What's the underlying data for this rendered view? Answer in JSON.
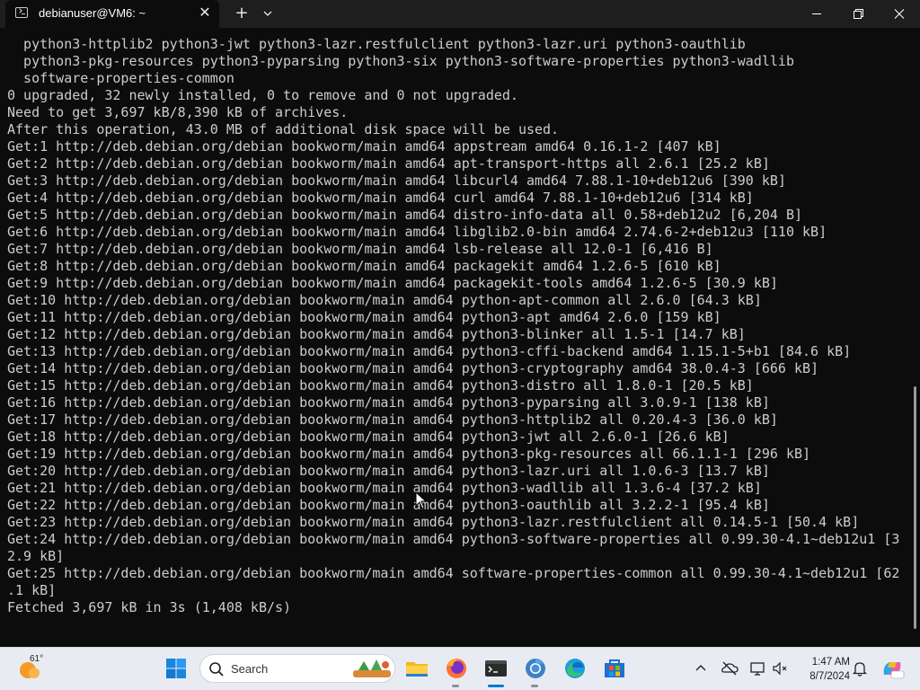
{
  "window": {
    "tab_title": "debianuser@VM6: ~",
    "tab_close_glyph": "✕",
    "new_tab_glyph": "+"
  },
  "terminal": {
    "lines": [
      "  python3-httplib2 python3-jwt python3-lazr.restfulclient python3-lazr.uri python3-oauthlib",
      "  python3-pkg-resources python3-pyparsing python3-six python3-software-properties python3-wadllib",
      "  software-properties-common",
      "0 upgraded, 32 newly installed, 0 to remove and 0 not upgraded.",
      "Need to get 3,697 kB/8,390 kB of archives.",
      "After this operation, 43.0 MB of additional disk space will be used.",
      "Get:1 http://deb.debian.org/debian bookworm/main amd64 appstream amd64 0.16.1-2 [407 kB]",
      "Get:2 http://deb.debian.org/debian bookworm/main amd64 apt-transport-https all 2.6.1 [25.2 kB]",
      "Get:3 http://deb.debian.org/debian bookworm/main amd64 libcurl4 amd64 7.88.1-10+deb12u6 [390 kB]",
      "Get:4 http://deb.debian.org/debian bookworm/main amd64 curl amd64 7.88.1-10+deb12u6 [314 kB]",
      "Get:5 http://deb.debian.org/debian bookworm/main amd64 distro-info-data all 0.58+deb12u2 [6,204 B]",
      "Get:6 http://deb.debian.org/debian bookworm/main amd64 libglib2.0-bin amd64 2.74.6-2+deb12u3 [110 kB]",
      "Get:7 http://deb.debian.org/debian bookworm/main amd64 lsb-release all 12.0-1 [6,416 B]",
      "Get:8 http://deb.debian.org/debian bookworm/main amd64 packagekit amd64 1.2.6-5 [610 kB]",
      "Get:9 http://deb.debian.org/debian bookworm/main amd64 packagekit-tools amd64 1.2.6-5 [30.9 kB]",
      "Get:10 http://deb.debian.org/debian bookworm/main amd64 python-apt-common all 2.6.0 [64.3 kB]",
      "Get:11 http://deb.debian.org/debian bookworm/main amd64 python3-apt amd64 2.6.0 [159 kB]",
      "Get:12 http://deb.debian.org/debian bookworm/main amd64 python3-blinker all 1.5-1 [14.7 kB]",
      "Get:13 http://deb.debian.org/debian bookworm/main amd64 python3-cffi-backend amd64 1.15.1-5+b1 [84.6 kB]",
      "Get:14 http://deb.debian.org/debian bookworm/main amd64 python3-cryptography amd64 38.0.4-3 [666 kB]",
      "Get:15 http://deb.debian.org/debian bookworm/main amd64 python3-distro all 1.8.0-1 [20.5 kB]",
      "Get:16 http://deb.debian.org/debian bookworm/main amd64 python3-pyparsing all 3.0.9-1 [138 kB]",
      "Get:17 http://deb.debian.org/debian bookworm/main amd64 python3-httplib2 all 0.20.4-3 [36.0 kB]",
      "Get:18 http://deb.debian.org/debian bookworm/main amd64 python3-jwt all 2.6.0-1 [26.6 kB]",
      "Get:19 http://deb.debian.org/debian bookworm/main amd64 python3-pkg-resources all 66.1.1-1 [296 kB]",
      "Get:20 http://deb.debian.org/debian bookworm/main amd64 python3-lazr.uri all 1.0.6-3 [13.7 kB]",
      "Get:21 http://deb.debian.org/debian bookworm/main amd64 python3-wadllib all 1.3.6-4 [37.2 kB]",
      "Get:22 http://deb.debian.org/debian bookworm/main amd64 python3-oauthlib all 3.2.2-1 [95.4 kB]",
      "Get:23 http://deb.debian.org/debian bookworm/main amd64 python3-lazr.restfulclient all 0.14.5-1 [50.4 kB]",
      "Get:24 http://deb.debian.org/debian bookworm/main amd64 python3-software-properties all 0.99.30-4.1~deb12u1 [3",
      "2.9 kB]",
      "Get:25 http://deb.debian.org/debian bookworm/main amd64 software-properties-common all 0.99.30-4.1~deb12u1 [62",
      ".1 kB]",
      "Fetched 3,697 kB in 3s (1,408 kB/s)"
    ]
  },
  "taskbar": {
    "weather_temp": "61°",
    "search_placeholder": "Search",
    "clock_time": "1:47 AM",
    "clock_date": "8/7/2024",
    "apps": [
      "start-icon",
      "file-explorer-icon",
      "firefox-icon",
      "terminal-icon",
      "chrome-icon",
      "edge-icon",
      "microsoft-store-icon"
    ],
    "tray": [
      "chevron-up-icon",
      "onedrive-icon",
      "network-icon",
      "volume-icon",
      "notification-bell-icon",
      "copilot-icon"
    ]
  },
  "colors": {
    "terminal_bg": "#0c0c0c",
    "terminal_fg": "#cccccc",
    "titlebar_bg": "#1e1e1e",
    "taskbar_bg": "#e8ecf2",
    "accent": "#0078d4"
  }
}
